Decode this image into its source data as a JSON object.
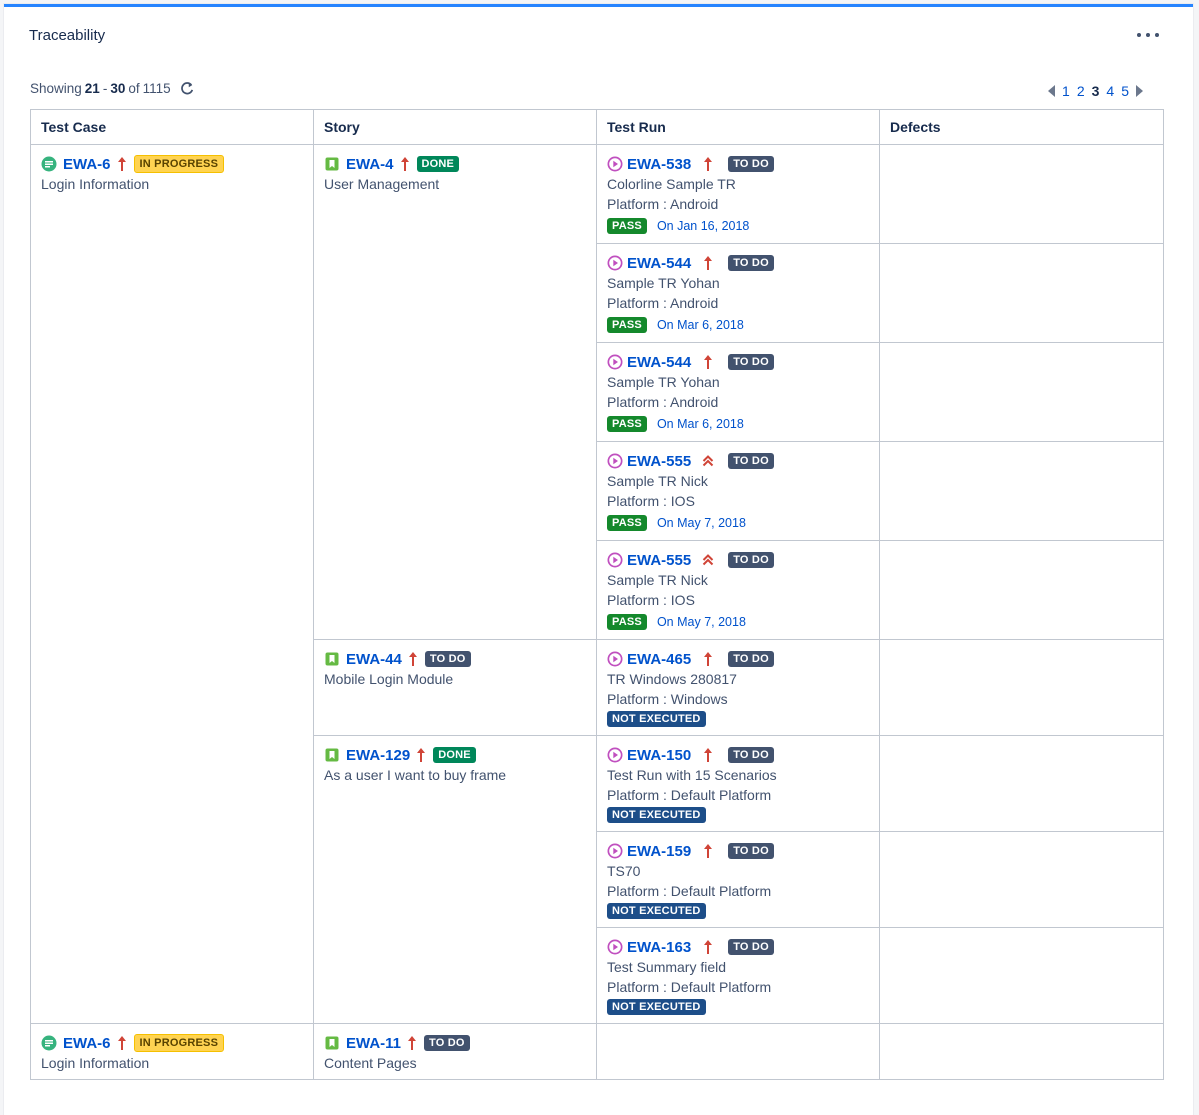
{
  "gadget": {
    "title": "Traceability",
    "more_label": "More actions"
  },
  "showing": {
    "prefix": "Showing",
    "from": "21",
    "dash": "-",
    "to": "30",
    "of": "of",
    "total": "1115"
  },
  "pager": {
    "pages": [
      "1",
      "2",
      "3",
      "4",
      "5"
    ],
    "current": "3"
  },
  "table": {
    "headers": [
      "Test Case",
      "Story",
      "Test Run",
      "Defects"
    ],
    "test_cases": [
      {
        "key": "EWA-6",
        "status": "IN PROGRESS",
        "summary": "Login Information",
        "icon": "test-case-icon",
        "priority": "high-priority-icon"
      },
      {
        "key": "EWA-6",
        "status": "IN PROGRESS",
        "summary": "Login Information",
        "icon": "test-case-icon",
        "priority": "high-priority-icon"
      }
    ],
    "stories": [
      {
        "key": "EWA-4",
        "status": "DONE",
        "summary": "User Management",
        "icon": "story-icon",
        "priority": "high-priority-icon"
      },
      {
        "key": "EWA-44",
        "status": "TO DO",
        "summary": "Mobile Login Module",
        "icon": "story-icon",
        "priority": "high-priority-icon"
      },
      {
        "key": "EWA-129",
        "status": "DONE",
        "summary": "As a user I want to buy frame",
        "icon": "story-icon",
        "priority": "high-priority-icon"
      },
      {
        "key": "EWA-11",
        "status": "TO DO",
        "summary": "Content Pages",
        "icon": "story-icon",
        "priority": "high-priority-icon"
      }
    ],
    "test_runs": [
      {
        "key": "EWA-538",
        "status": "TO DO",
        "summary": "Colorline Sample TR",
        "platform": "Platform : Android",
        "result": "PASS",
        "date": "On Jan 16, 2018",
        "icon": "test-run-icon",
        "priority": "high-priority-icon"
      },
      {
        "key": "EWA-544",
        "status": "TO DO",
        "summary": "Sample TR Yohan",
        "platform": "Platform : Android",
        "result": "PASS",
        "date": "On Mar 6, 2018",
        "icon": "test-run-icon",
        "priority": "high-priority-icon"
      },
      {
        "key": "EWA-544",
        "status": "TO DO",
        "summary": "Sample TR Yohan",
        "platform": "Platform : Android",
        "result": "PASS",
        "date": "On Mar 6, 2018",
        "icon": "test-run-icon",
        "priority": "high-priority-icon"
      },
      {
        "key": "EWA-555",
        "status": "TO DO",
        "summary": "Sample TR Nick",
        "platform": "Platform : IOS",
        "result": "PASS",
        "date": "On May 7, 2018",
        "icon": "test-run-icon",
        "priority": "highest-priority-icon"
      },
      {
        "key": "EWA-555",
        "status": "TO DO",
        "summary": "Sample TR Nick",
        "platform": "Platform : IOS",
        "result": "PASS",
        "date": "On May 7, 2018",
        "icon": "test-run-icon",
        "priority": "highest-priority-icon"
      },
      {
        "key": "EWA-465",
        "status": "TO DO",
        "summary": "TR Windows 280817",
        "platform": "Platform : Windows",
        "result": "NOT EXECUTED",
        "date": "",
        "icon": "test-run-icon",
        "priority": "high-priority-icon"
      },
      {
        "key": "EWA-150",
        "status": "TO DO",
        "summary": "Test Run with 15 Scenarios",
        "platform": "Platform : Default Platform",
        "result": "NOT EXECUTED",
        "date": "",
        "icon": "test-run-icon",
        "priority": "high-priority-icon"
      },
      {
        "key": "EWA-159",
        "status": "TO DO",
        "summary": "TS70",
        "platform": "Platform : Default Platform",
        "result": "NOT EXECUTED",
        "date": "",
        "icon": "test-run-icon",
        "priority": "high-priority-icon"
      },
      {
        "key": "EWA-163",
        "status": "TO DO",
        "summary": "Test Summary field",
        "platform": "Platform : Default Platform",
        "result": "NOT EXECUTED",
        "date": "",
        "icon": "test-run-icon",
        "priority": "high-priority-icon"
      }
    ]
  },
  "colors": {
    "accent": "#2684ff",
    "link": "#0052cc",
    "test_case_icon": "#36b37e",
    "story_icon": "#65ba43",
    "test_run_icon": "#c04fbf",
    "priority": "#d04437"
  }
}
